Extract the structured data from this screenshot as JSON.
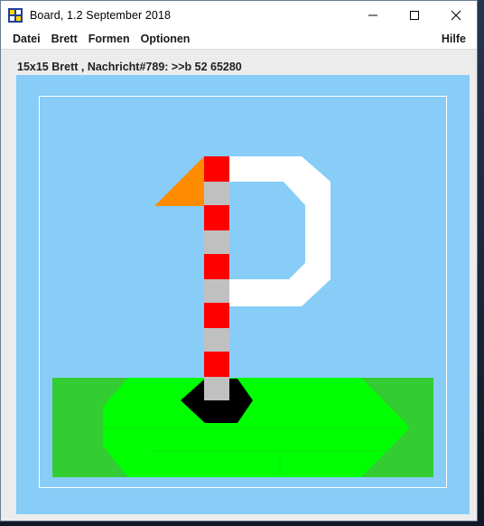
{
  "window": {
    "title": "Board, 1.2 September 2018",
    "icon": "board-app-icon",
    "controls": [
      "minimize-icon",
      "maximize-icon",
      "close-icon"
    ]
  },
  "menu": {
    "items": [
      "Datei",
      "Brett",
      "Formen",
      "Optionen"
    ],
    "help": "Hilfe"
  },
  "status": {
    "text": "15x15 Brett , Nachricht#789: >>b 52 65280"
  },
  "board": {
    "grid_size": "15x15",
    "background": "#87cdf7",
    "colors": {
      "grass": "#33cc33",
      "green": "#00ff00",
      "hole": "#000000",
      "flag": "#ff8c00",
      "pole_red": "#ff0000",
      "pole_gray": "#c0c0c0",
      "letter": "#ffffff"
    },
    "letter": "P"
  }
}
